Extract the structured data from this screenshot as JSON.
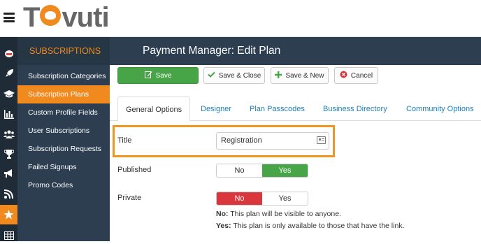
{
  "app": {
    "logo_text_pre": "T",
    "logo_text_post": "vuti"
  },
  "sidebar": {
    "heading": "SUBSCRIPTIONS",
    "items": [
      {
        "label": "Subscription Categories"
      },
      {
        "label": "Subscription Plans"
      },
      {
        "label": "Custom Profile Fields"
      },
      {
        "label": "User Subscriptions"
      },
      {
        "label": "Subscription Requests"
      },
      {
        "label": "Failed Signups"
      },
      {
        "label": "Promo Codes"
      }
    ]
  },
  "rail_icons": [
    "cake-icon",
    "rocket-icon",
    "graduation-cap-icon",
    "bar-chart-icon",
    "users-icon",
    "trophy-icon",
    "bullhorn-icon",
    "rss-icon",
    "star-icon",
    "table-icon"
  ],
  "header": {
    "title": "Payment Manager: Edit Plan"
  },
  "toolbar": {
    "save": "Save",
    "save_close": "Save & Close",
    "save_new": "Save & New",
    "cancel": "Cancel"
  },
  "tabs": [
    {
      "label": "General Options"
    },
    {
      "label": "Designer"
    },
    {
      "label": "Plan Passcodes"
    },
    {
      "label": "Business Directory"
    },
    {
      "label": "Community Options"
    }
  ],
  "form": {
    "title_label": "Title",
    "title_value": "Registration",
    "published_label": "Published",
    "published_no": "No",
    "published_yes": "Yes",
    "published_selected": "Yes",
    "private_label": "Private",
    "private_no": "No",
    "private_yes": "Yes",
    "private_selected": "No",
    "help_no_key": "No:",
    "help_no_text": " This plan will be visible to anyone.",
    "help_yes_key": "Yes:",
    "help_yes_text": " This plan is only available to those that have the link."
  },
  "colors": {
    "accent": "#f08a1e",
    "sidebar": "#2c3e50",
    "success": "#47a447",
    "danger": "#d9363e",
    "link": "#1a7fc1"
  }
}
